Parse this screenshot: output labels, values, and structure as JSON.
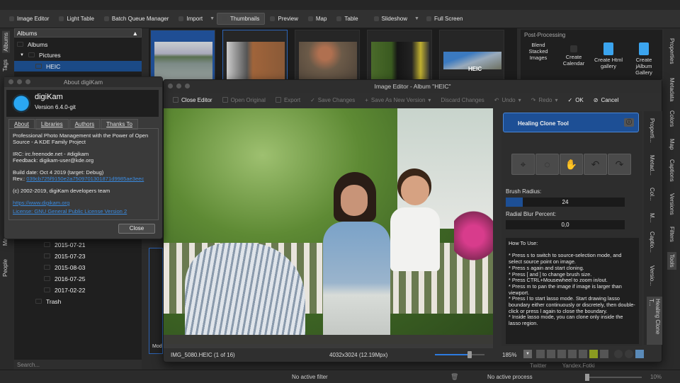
{
  "toolbar": {
    "items": [
      "Image Editor",
      "Light Table",
      "Batch Queue Manager",
      "Import",
      "Thumbnails",
      "Preview",
      "Map",
      "Table",
      "Slideshow",
      "Full Screen"
    ],
    "active": "Thumbnails"
  },
  "left_tabs": [
    "Albums",
    "Tags",
    "Ma",
    "People"
  ],
  "albums": {
    "header": "Albums",
    "root": "Albums",
    "pictures": "Pictures",
    "selected": "HEIC",
    "dates": [
      "2015-07-21",
      "2015-07-23",
      "2015-08-03",
      "2016-07-25",
      "2017-02-22"
    ],
    "trash": "Trash",
    "search_placeholder": "Search..."
  },
  "thumbnails": {
    "heic_badge": "HEIC",
    "partial_label": "Mod"
  },
  "post_processing": {
    "title": "Post-Processing",
    "items": [
      "Blend Stacked Images",
      "Create Calendar",
      "Create Html gallery",
      "Create jAlbum Gallery"
    ]
  },
  "right_tabs": [
    "Properties",
    "Metadata",
    "Colors",
    "Map",
    "Captions",
    "Versions",
    "Filters",
    "Tools"
  ],
  "about": {
    "title": "About digiKam",
    "app": "digiKam",
    "version": "Version 6.4.0-git",
    "tabs": [
      "About",
      "Libraries",
      "Authors",
      "Thanks To"
    ],
    "desc": "Professional Photo Management with the Power of Open Source - A KDE Family Project",
    "irc": "IRC: irc.freenode.net - #digikam",
    "feedback": "Feedback: digikam-user@kde.org",
    "build": "Build date: Oct 4 2019 (target: Debug)",
    "rev_label": "Rev.:",
    "rev": "039cb725f9150e2a7509701301871d9985ae3eec",
    "copyright": "(c) 2002-2019, digiKam developers team",
    "url": "https://www.digikam.org",
    "license": "License: GNU General Public License Version 2",
    "close": "Close"
  },
  "editor": {
    "title": "Image Editor - Album \"HEIC\"",
    "toolbar": [
      "Close Editor",
      "Open Original",
      "Export",
      "Save Changes",
      "Save As New Version",
      "Discard Changes",
      "Undo",
      "Redo",
      "OK",
      "Cancel"
    ],
    "tool": "Healing Clone Tool",
    "brush_label": "Brush Radius:",
    "brush_value": "24",
    "brush_fraction": 0.14,
    "blur_label": "Radial Blur Percent:",
    "blur_value": "0,0",
    "howto": [
      "How To Use:",
      "",
      "* Press s to switch to source-selection mode, and select source point on image.",
      "* Press s again and start cloning.",
      "* Press [ and ] to change brush size.",
      "* Press CTRL+Mousewheel to zoom in/out.",
      "* Press m to pan the image if image is larger than viewport.",
      "* Press l to start lasso mode. Start drawing lasso boundary either continuously or discretely, then double-click or press l again to close the boundary.",
      "* Inside lasso mode, you can clone only inside the lasso region."
    ],
    "side_tabs": [
      "Properti...",
      "Metad...",
      "Col...",
      "M...",
      "Captio...",
      "Versio...",
      "Healing Clone T..."
    ],
    "filename": "IMG_5080.HEIC (1 of 16)",
    "dimensions": "4032x3024 (12.19Mpx)",
    "zoom": "185%",
    "zoom_slider_fraction": 0.7
  },
  "share": [
    "Twitter",
    "Yandex.Fotki"
  ],
  "status": {
    "filter": "No active filter",
    "process": "No active process",
    "zoom": "10%"
  },
  "colors": {
    "accent": "#1f4e94",
    "link": "#3a8be0"
  }
}
